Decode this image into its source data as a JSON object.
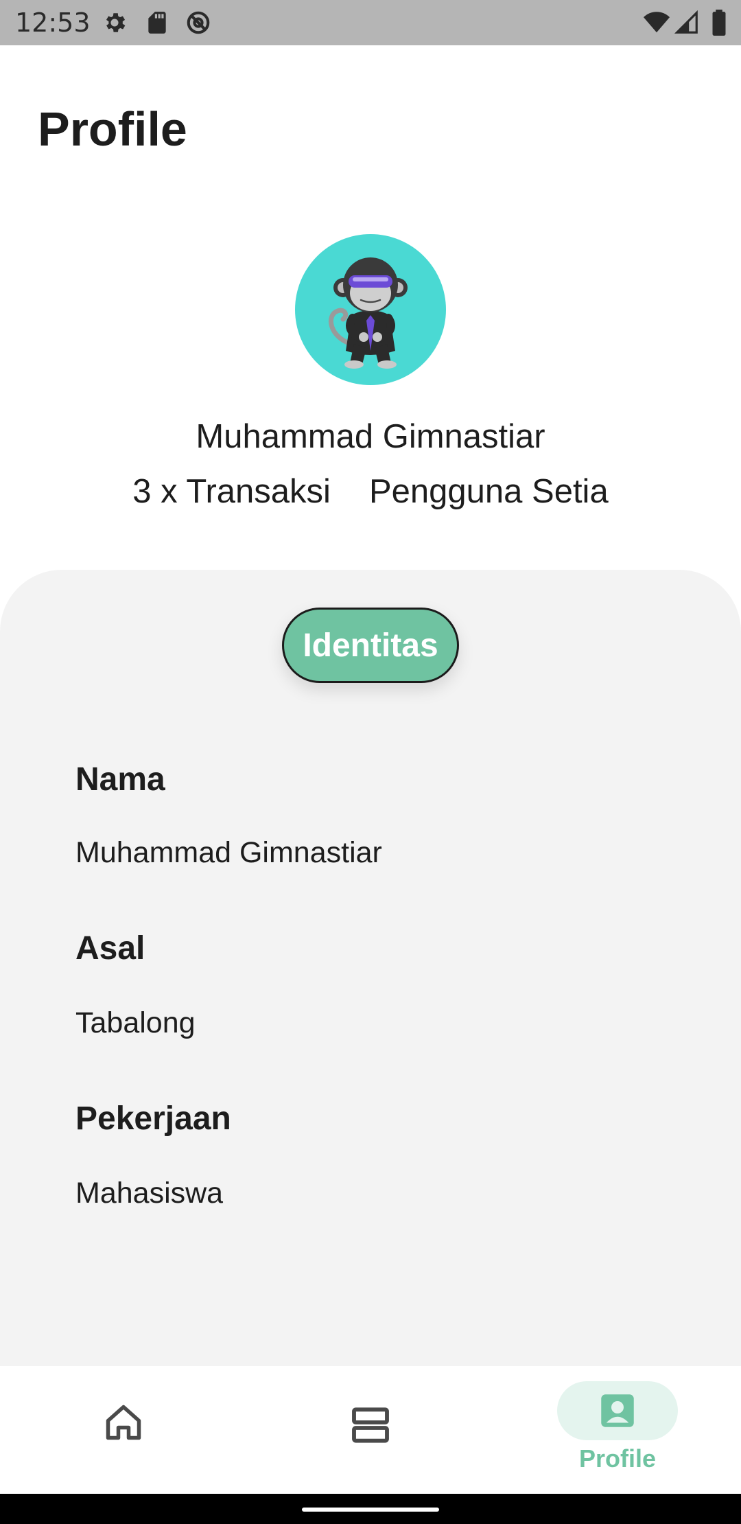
{
  "status_bar": {
    "time": "12:53",
    "icons": [
      "gear-icon",
      "sd-card-icon",
      "at-sign-icon",
      "wifi-icon",
      "cell-signal-icon",
      "battery-icon"
    ]
  },
  "header": {
    "title": "Profile"
  },
  "profile": {
    "avatar": "monkey-avatar",
    "name": "Muhammad Gimnastiar",
    "transactions": "3 x Transaksi",
    "badge": "Pengguna Setia"
  },
  "card": {
    "tab_label": "Identitas",
    "fields": [
      {
        "label": "Nama",
        "value": "Muhammad Gimnastiar"
      },
      {
        "label": "Asal",
        "value": "Tabalong"
      },
      {
        "label": "Pekerjaan",
        "value": "Mahasiswa"
      }
    ]
  },
  "bottom_nav": {
    "items": [
      {
        "icon": "home-icon",
        "label": ""
      },
      {
        "icon": "list-icon",
        "label": ""
      },
      {
        "icon": "profile-icon",
        "label": "Profile",
        "active": true
      }
    ]
  },
  "colors": {
    "accent": "#6fc3a1",
    "avatar_bg": "#4ad9d3",
    "card_bg": "#f3f3f3",
    "status_bar_bg": "#b5b5b5"
  }
}
